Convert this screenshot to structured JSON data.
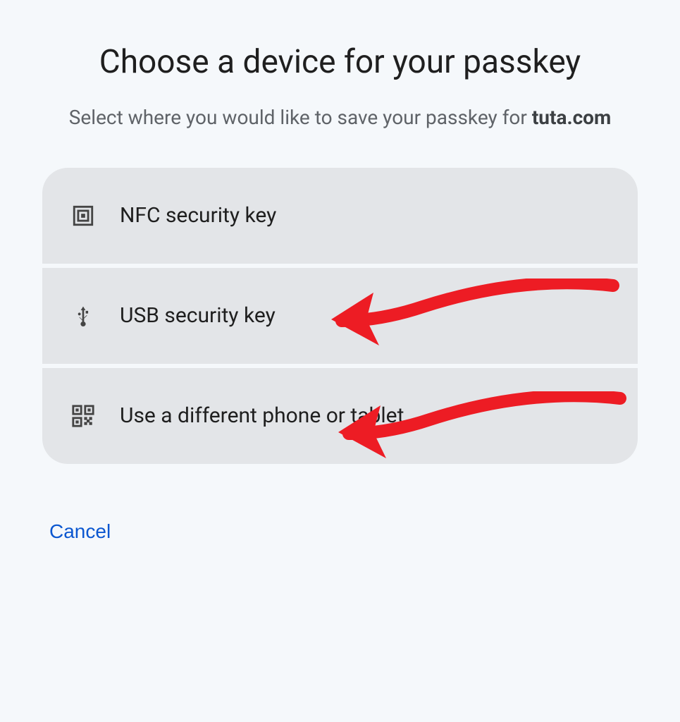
{
  "dialog": {
    "title": "Choose a device for your passkey",
    "subtitle_prefix": "Select where you would like to save your passkey for ",
    "subtitle_domain": "tuta.com",
    "options": [
      {
        "label": "NFC security key"
      },
      {
        "label": "USB security key"
      },
      {
        "label": "Use a different phone or tablet"
      }
    ],
    "cancel_label": "Cancel"
  },
  "annotations": {
    "arrow_color": "#ed1c24"
  }
}
